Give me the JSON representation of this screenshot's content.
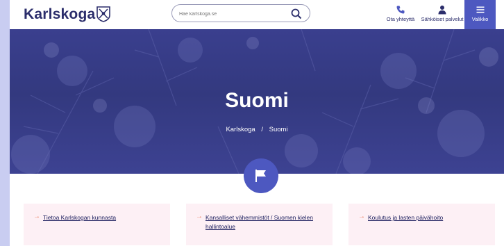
{
  "header": {
    "logo_text": "Karlskoga",
    "search_placeholder": "Hae karlskoga.se",
    "contact_label": "Ota yhteyttä",
    "eservices_label": "Sähköiset palvelut",
    "menu_label": "Valikko"
  },
  "hero": {
    "title": "Suomi",
    "breadcrumb": {
      "home": "Karlskoga",
      "separator": "/",
      "current": "Suomi"
    }
  },
  "cards": [
    {
      "label": "Tietoa Karlskogan kunnasta"
    },
    {
      "label": "Kansalliset vähemmistöt / Suomen kielen hallintoalue"
    },
    {
      "label": "Koulutus ja lasten päivähoito"
    }
  ],
  "colors": {
    "brand_dark": "#2b2d6b",
    "accent": "#4d58c0",
    "hero_overlay": "#3a3f8e",
    "card_bg": "#fdf0f5",
    "arrow": "#e8795b"
  },
  "icons": {
    "crest": "coat-of-arms-icon",
    "search": "search-icon",
    "contact": "phone-icon",
    "eservices": "person-icon",
    "menu": "hamburger-icon",
    "hero": "flag-icon",
    "card_arrow": "arrow-right-icon"
  }
}
